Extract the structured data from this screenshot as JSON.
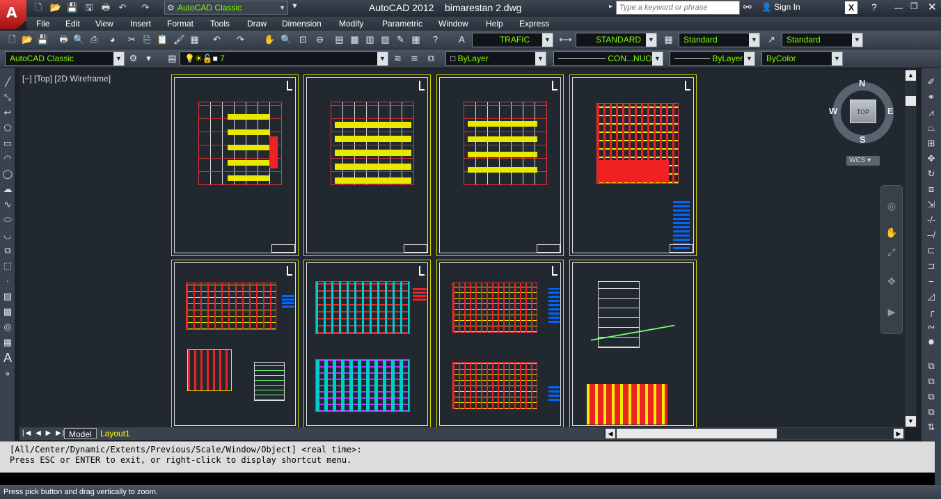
{
  "app": {
    "logo_letter": "A",
    "title": "AutoCAD 2012",
    "document": "bimarestan 2.dwg",
    "workspace": "AutoCAD Classic",
    "search_placeholder": "Type a keyword or phrase",
    "sign_in": "Sign In"
  },
  "menus": [
    "File",
    "Edit",
    "View",
    "Insert",
    "Format",
    "Tools",
    "Draw",
    "Dimension",
    "Modify",
    "Parametric",
    "Window",
    "Help",
    "Express"
  ],
  "styles_toolbar": {
    "text_style": "TRAFIC",
    "dim_style": "STANDARD",
    "table_style": "Standard",
    "mleader_style": "Standard"
  },
  "layers_toolbar": {
    "workspace": "AutoCAD Classic",
    "layer": "7",
    "color": "ByLayer",
    "linetype": "CON...NUOUS",
    "lineweight": "ByLayer",
    "plotstyle": "ByColor"
  },
  "viewport": {
    "label": "[−] [Top] [2D Wireframe]"
  },
  "viewcube": {
    "top": "TOP",
    "n": "N",
    "s": "S",
    "e": "E",
    "w": "W",
    "wcs": "WCS"
  },
  "tabs": {
    "model": "Model",
    "layout1": "Layout1"
  },
  "command": {
    "line1": "[All/Center/Dynamic/Extents/Previous/Scale/Window/Object] <real time>:",
    "line2": "Press ESC or ENTER to exit, or right-click to display shortcut menu."
  },
  "status": "Press pick button and drag vertically to zoom.",
  "colors": {
    "canvas": "#212830",
    "sheet_border": "#d8d800",
    "accent_green": "#7cfc00"
  }
}
